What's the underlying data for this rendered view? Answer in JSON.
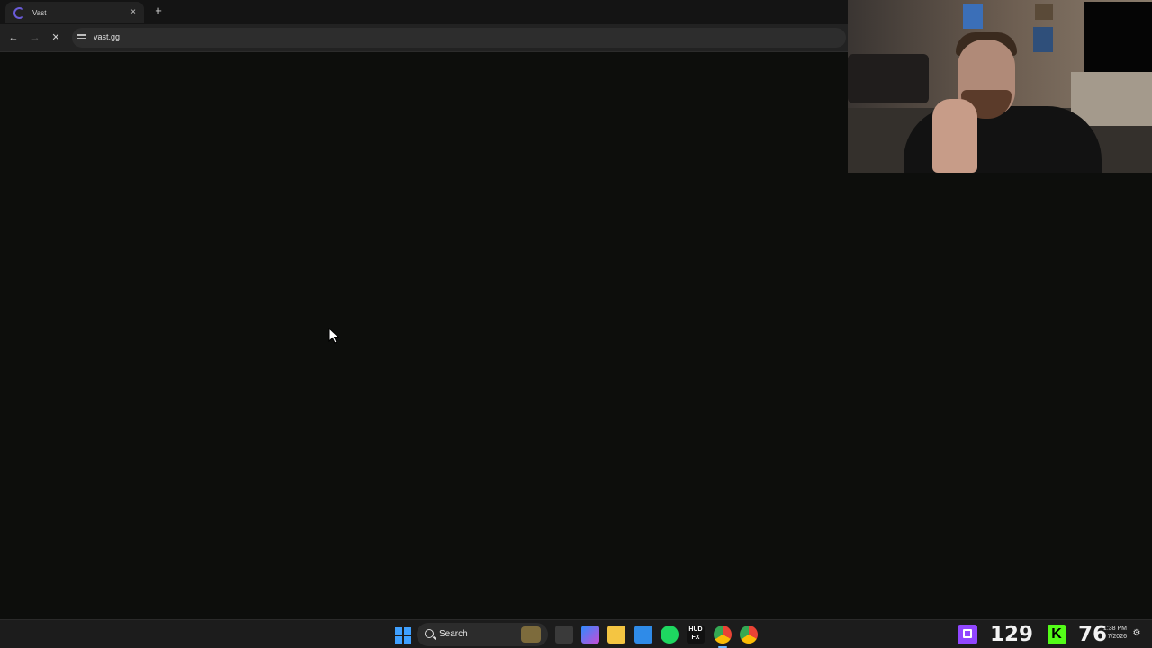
{
  "browser": {
    "tab": {
      "title": "Vast",
      "icon": "loading-spinner-icon"
    },
    "new_tab_label": "+",
    "close_tab_label": "×",
    "nav": {
      "back": "←",
      "forward": "→",
      "stop": "✕"
    },
    "url": "vast.gg"
  },
  "taskbar": {
    "search_label": "Search",
    "icons": [
      "windows-start-icon",
      "search-icon",
      "task-view-icon",
      "copilot-icon",
      "file-explorer-icon",
      "notepad-icon",
      "spotify-icon",
      "hud-fx-icon",
      "chrome-icon",
      "chrome-alt-icon"
    ],
    "hud_label": "HUD FX",
    "twitch_viewers": "129",
    "kick_viewers": "76",
    "kick_letter": "K",
    "clock": {
      "time": "1:38 PM",
      "date": "7/2026"
    },
    "notification_icon": "bell-icon"
  },
  "colors": {
    "page_bg": "#0d0e0c",
    "tab_bg": "#222222",
    "twitch": "#9146ff",
    "kick": "#53fc18",
    "windows_blue": "#3fa0ff"
  }
}
